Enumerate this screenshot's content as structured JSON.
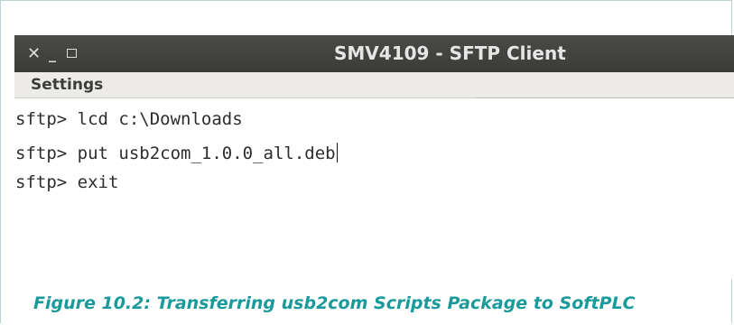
{
  "window": {
    "title": "SMV4109 - SFTP Client",
    "controls": {
      "close_glyph": "✕",
      "minimize_glyph": "_",
      "maximize_icon": "maximize-icon"
    }
  },
  "menubar": {
    "items": [
      {
        "label": "Settings"
      }
    ]
  },
  "terminal": {
    "lines": [
      {
        "text": "sftp> lcd c:\\Downloads"
      },
      {
        "text": "sftp> put usb2com_1.0.0_all.deb"
      },
      {
        "text": "sftp> exit"
      }
    ]
  },
  "caption": "Figure 10.2: Transferring usb2com Scripts Package to SoftPLC",
  "colors": {
    "titlebar": "#3b3b39",
    "menubar": "#ecebe7",
    "caption": "#1a9a9a"
  }
}
